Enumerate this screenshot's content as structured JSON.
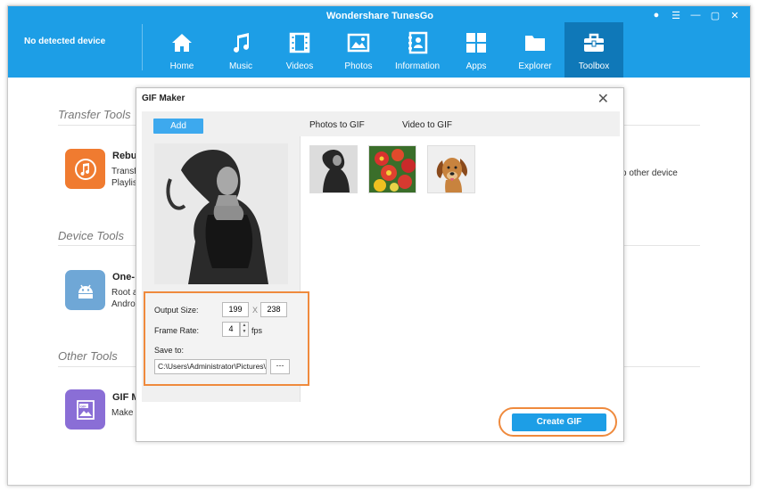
{
  "app": {
    "title": "Wondershare TunesGo",
    "device_status": "No detected device"
  },
  "window_controls": [
    "user-icon",
    "menu-icon",
    "minimize-icon",
    "maximize-icon",
    "close-icon"
  ],
  "nav": [
    {
      "label": "Home",
      "icon": "home-icon"
    },
    {
      "label": "Music",
      "icon": "music-icon"
    },
    {
      "label": "Videos",
      "icon": "videos-icon"
    },
    {
      "label": "Photos",
      "icon": "photos-icon"
    },
    {
      "label": "Information",
      "icon": "contacts-icon"
    },
    {
      "label": "Apps",
      "icon": "apps-icon"
    },
    {
      "label": "Explorer",
      "icon": "folder-icon"
    },
    {
      "label": "Toolbox",
      "icon": "toolbox-icon",
      "active": true
    }
  ],
  "sections": {
    "transfer": "Transfer Tools",
    "device": "Device Tools",
    "other": "Other Tools"
  },
  "tools": {
    "rebuild": {
      "name": "Rebu",
      "desc1": "Transf",
      "desc2": "Playlis",
      "desc_right": "o other device"
    },
    "root": {
      "name": "One-",
      "desc1": "Root a",
      "desc2": "Andro"
    },
    "gif": {
      "name": "GIF M",
      "desc1": "Make"
    }
  },
  "dialog": {
    "title": "GIF Maker",
    "add_label": "Add",
    "tabs": [
      "Photos to GIF",
      "Video to GIF"
    ],
    "settings": {
      "output_size_label": "Output Size:",
      "width": "199",
      "x_sep": "X",
      "height": "238",
      "frame_rate_label": "Frame Rate:",
      "frame_rate": "4",
      "fps_label": "fps",
      "save_to_label": "Save to:",
      "save_path": "C:\\Users\\Administrator\\Pictures\\\\",
      "browse_label": "---"
    },
    "create_label": "Create GIF"
  },
  "colors": {
    "accent": "#1d9ee6",
    "highlight": "#ef8a3d",
    "toolbox_active": "#0f78b8"
  }
}
